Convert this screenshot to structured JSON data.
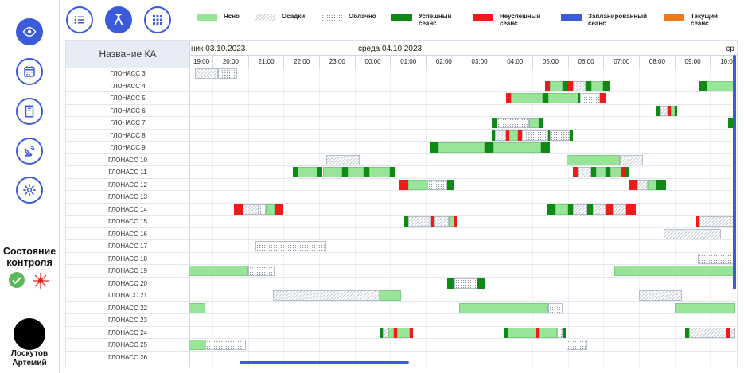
{
  "sidebar": {
    "items": [
      {
        "name": "eye-icon",
        "active": true
      },
      {
        "name": "calendar-icon",
        "active": false
      },
      {
        "name": "book-icon",
        "active": false
      },
      {
        "name": "satellite-dish-icon",
        "active": false
      },
      {
        "name": "gear-icon",
        "active": false
      }
    ],
    "state_title": "Состояние контроля",
    "state_icons": [
      "check-circle-icon",
      "laser-icon"
    ],
    "user_name": "Лоскутов Артемий"
  },
  "toolbar": {
    "buttons": [
      {
        "name": "list-view-icon",
        "active": false
      },
      {
        "name": "ribbon-icon",
        "active": true
      },
      {
        "name": "grid-view-icon",
        "active": false
      }
    ]
  },
  "legend": [
    {
      "label": "Ясно",
      "kind": "clear"
    },
    {
      "label": "Осадки",
      "kind": "rain"
    },
    {
      "label": "Облачно",
      "kind": "cloud"
    },
    {
      "label": "Успешный\nсеанс",
      "kind": "ok",
      "color": "#0e8a15"
    },
    {
      "label": "Неуспешный\nсеанс",
      "kind": "fail",
      "color": "#ee1b1b"
    },
    {
      "label": "Запланированный\nсеанс",
      "kind": "planned",
      "color": "#3b5bdb"
    },
    {
      "label": "Текущий\nсеанс",
      "kind": "current",
      "color": "#f07a1a"
    }
  ],
  "gantt": {
    "names_header": "Название КА",
    "dates": [
      {
        "label": "ник 03.10.2023",
        "hour": 18.85
      },
      {
        "label": "среда 04.10.2023",
        "hour": 23.55
      },
      {
        "label": "ср",
        "hour": 33.9
      }
    ],
    "hours": [
      "19:00",
      "20:00",
      "21:00",
      "22:00",
      "23:00",
      "00:00",
      "01:00",
      "02:00",
      "03:00",
      "04:00",
      "05:00",
      "06:00",
      "07:00",
      "08:00",
      "09:00",
      "10:00"
    ],
    "first_hour": 19,
    "satellites": [
      {
        "name": "ГЛОНАСС 3",
        "segs": [
          [
            "rain",
            19.0,
            19.65
          ],
          [
            "cloud",
            19.65,
            20.2
          ]
        ]
      },
      {
        "name": "ГЛОНАСС 4",
        "segs": [
          [
            "fail",
            28.85,
            29.0
          ],
          [
            "clear",
            29.0,
            29.35
          ],
          [
            "ok",
            29.35,
            29.5
          ],
          [
            "fail",
            29.5,
            29.65
          ],
          [
            "rain",
            29.65,
            30.0
          ],
          [
            "ok",
            30.0,
            30.15
          ],
          [
            "clear",
            30.15,
            30.5
          ],
          [
            "ok",
            30.5,
            30.7
          ],
          [
            "ok",
            33.2,
            33.4
          ],
          [
            "clear",
            33.4,
            34.2
          ]
        ]
      },
      {
        "name": "ГЛОНАСС 5",
        "segs": [
          [
            "fail",
            27.75,
            27.9
          ],
          [
            "clear",
            27.9,
            28.8
          ],
          [
            "ok",
            28.8,
            28.95
          ],
          [
            "clear",
            28.95,
            29.8
          ],
          [
            "ok",
            29.8,
            29.85
          ],
          [
            "cloud",
            29.85,
            30.4
          ],
          [
            "fail",
            30.4,
            30.55
          ]
        ]
      },
      {
        "name": "ГЛОНАСС 6",
        "segs": [
          [
            "ok",
            32.0,
            32.1
          ],
          [
            "rain",
            32.1,
            32.3
          ],
          [
            "fail",
            32.3,
            32.4
          ],
          [
            "clear",
            32.4,
            32.5
          ],
          [
            "ok",
            32.5,
            32.58
          ]
        ]
      },
      {
        "name": "ГЛОНАСС 7",
        "segs": [
          [
            "ok",
            27.35,
            27.5
          ],
          [
            "cloud",
            27.5,
            28.4
          ],
          [
            "clear",
            28.4,
            28.7
          ],
          [
            "ok",
            28.7,
            28.8
          ],
          [
            "ok",
            34.0,
            34.2
          ]
        ]
      },
      {
        "name": "ГЛОНАСС 8",
        "segs": [
          [
            "ok",
            27.35,
            27.45
          ],
          [
            "rain",
            27.45,
            27.75
          ],
          [
            "fail",
            27.75,
            27.85
          ],
          [
            "clear",
            27.85,
            28.1
          ],
          [
            "fail",
            28.1,
            28.2
          ],
          [
            "cloud",
            28.2,
            28.95
          ],
          [
            "ok",
            28.95,
            29.0
          ],
          [
            "cloud",
            29.0,
            29.55
          ],
          [
            "ok",
            29.55,
            29.65
          ]
        ]
      },
      {
        "name": "ГЛОНАСС 9",
        "segs": [
          [
            "ok",
            25.6,
            25.85
          ],
          [
            "clear",
            25.85,
            27.15
          ],
          [
            "ok",
            27.15,
            27.4
          ],
          [
            "clear",
            27.4,
            28.75
          ],
          [
            "ok",
            28.75,
            29.0
          ]
        ]
      },
      {
        "name": "ГЛОНАСС 10",
        "segs": [
          [
            "rain",
            22.7,
            23.65
          ],
          [
            "clear",
            29.45,
            30.95
          ],
          [
            "rain",
            30.95,
            31.6
          ]
        ]
      },
      {
        "name": "ГЛОНАСС 11",
        "segs": [
          [
            "ok",
            21.75,
            21.9
          ],
          [
            "clear",
            21.9,
            22.45
          ],
          [
            "ok",
            22.45,
            22.6
          ],
          [
            "clear",
            22.6,
            23.15
          ],
          [
            "ok",
            23.15,
            23.3
          ],
          [
            "clear",
            23.3,
            23.75
          ],
          [
            "ok",
            23.75,
            23.9
          ],
          [
            "clear",
            23.9,
            24.5
          ],
          [
            "ok",
            24.5,
            24.65
          ],
          [
            "fail",
            29.65,
            29.8
          ],
          [
            "rain",
            29.8,
            30.15
          ],
          [
            "ok",
            30.15,
            30.3
          ],
          [
            "clear",
            30.3,
            30.55
          ],
          [
            "ok",
            30.55,
            30.7
          ],
          [
            "clear",
            30.7,
            31.0
          ],
          [
            "fail",
            31.0,
            31.1
          ],
          [
            "ok",
            31.1,
            31.2
          ]
        ]
      },
      {
        "name": "ГЛОНАСС 12",
        "segs": [
          [
            "fail",
            24.75,
            25.0
          ],
          [
            "clear",
            25.0,
            25.55
          ],
          [
            "cloud",
            25.55,
            26.1
          ],
          [
            "ok",
            26.1,
            26.3
          ],
          [
            "fail",
            31.2,
            31.45
          ],
          [
            "rain",
            31.45,
            31.75
          ],
          [
            "clear",
            31.75,
            32.0
          ],
          [
            "ok",
            32.0,
            32.25
          ]
        ]
      },
      {
        "name": "ГЛОНАСС 13",
        "segs": []
      },
      {
        "name": "ГЛОНАСС 14",
        "segs": [
          [
            "fail",
            20.1,
            20.35
          ],
          [
            "rain",
            20.35,
            20.8
          ],
          [
            "cloud",
            20.8,
            21.0
          ],
          [
            "clear",
            21.0,
            21.25
          ],
          [
            "fail",
            21.25,
            21.5
          ],
          [
            "ok",
            28.9,
            29.15
          ],
          [
            "clear",
            29.15,
            29.5
          ],
          [
            "ok",
            29.5,
            29.65
          ],
          [
            "rain",
            29.65,
            30.05
          ],
          [
            "ok",
            30.05,
            30.2
          ],
          [
            "rain",
            30.2,
            30.55
          ],
          [
            "fail",
            30.55,
            30.75
          ],
          [
            "rain",
            30.75,
            31.15
          ],
          [
            "fail",
            31.15,
            31.4
          ]
        ]
      },
      {
        "name": "ГЛОНАСС 15",
        "segs": [
          [
            "ok",
            24.9,
            25.0
          ],
          [
            "rain",
            25.0,
            25.65
          ],
          [
            "fail",
            25.65,
            25.75
          ],
          [
            "rain",
            25.75,
            26.15
          ],
          [
            "clear",
            26.15,
            26.3
          ],
          [
            "fail",
            26.3,
            26.38
          ],
          [
            "fail",
            33.1,
            33.2
          ],
          [
            "rain",
            33.2,
            34.2
          ]
        ]
      },
      {
        "name": "ГЛОНАСС 16",
        "segs": [
          [
            "rain",
            32.2,
            33.8
          ]
        ]
      },
      {
        "name": "ГЛОНАСС 17",
        "segs": [
          [
            "cloud",
            20.7,
            22.7
          ]
        ]
      },
      {
        "name": "ГЛОНАСС 18",
        "segs": [
          [
            "cloud",
            33.15,
            34.2
          ]
        ]
      },
      {
        "name": "ГЛОНАСС 19",
        "segs": [
          [
            "clear",
            18.7,
            20.5
          ],
          [
            "cloud",
            20.5,
            21.25
          ],
          [
            "clear",
            30.8,
            34.2
          ]
        ]
      },
      {
        "name": "ГЛОНАСС 20",
        "segs": [
          [
            "ok",
            26.1,
            26.3
          ],
          [
            "cloud",
            26.3,
            26.95
          ],
          [
            "ok",
            26.95,
            27.15
          ]
        ]
      },
      {
        "name": "ГЛОНАСС 21",
        "segs": [
          [
            "rain",
            21.2,
            24.2
          ],
          [
            "clear",
            24.2,
            24.8
          ],
          [
            "rain",
            31.5,
            32.7
          ]
        ]
      },
      {
        "name": "ГЛОНАСС 22",
        "segs": [
          [
            "clear",
            18.7,
            19.3
          ],
          [
            "clear",
            26.45,
            28.95
          ],
          [
            "cloud",
            28.95,
            29.35
          ],
          [
            "clear",
            32.5,
            34.2
          ]
        ]
      },
      {
        "name": "ГЛОНАСС 23",
        "segs": []
      },
      {
        "name": "ГЛОНАСС 24",
        "segs": [
          [
            "ok",
            24.2,
            24.3
          ],
          [
            "rain",
            24.3,
            24.45
          ],
          [
            "clear",
            24.45,
            24.6
          ],
          [
            "fail",
            24.6,
            24.7
          ],
          [
            "clear",
            24.7,
            25.05
          ],
          [
            "fail",
            25.05,
            25.15
          ],
          [
            "ok",
            27.7,
            27.8
          ],
          [
            "clear",
            27.8,
            28.6
          ],
          [
            "fail",
            28.6,
            28.7
          ],
          [
            "clear",
            28.7,
            29.2
          ],
          [
            "cloud",
            29.2,
            29.35
          ],
          [
            "ok",
            29.35,
            29.45
          ],
          [
            "ok",
            32.8,
            32.9
          ],
          [
            "rain",
            32.9,
            33.95
          ],
          [
            "fail",
            33.95,
            34.05
          ],
          [
            "rain",
            34.05,
            34.2
          ]
        ]
      },
      {
        "name": "ГЛОНАСС 25",
        "segs": [
          [
            "clear",
            18.7,
            19.3
          ],
          [
            "cloud",
            19.3,
            20.45
          ],
          [
            "cloud",
            29.45,
            30.05
          ]
        ]
      },
      {
        "name": "ГЛОНАСС 26",
        "segs": []
      }
    ]
  }
}
